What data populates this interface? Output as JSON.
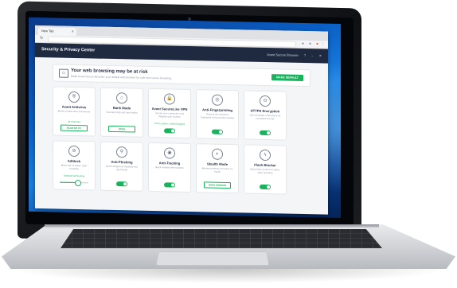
{
  "browser": {
    "tab_title": "New Tab",
    "tab_close": "✕",
    "refresh_icon": "↻"
  },
  "app": {
    "title": "Security & Privacy Center",
    "header_tools": [
      "Avast Secure Browser",
      "?",
      "–",
      "✕"
    ]
  },
  "banner": {
    "title": "Your web browsing may be at risk",
    "subtitle": "Make Avast Secure Browser your default web browser for safe and secure browsing.",
    "button_label": "MAKE DEFAULT"
  },
  "cards": [
    {
      "title": "Avast Antivirus",
      "desc": "Blocks viruses and ransomware",
      "status": "All Protected",
      "control": "button",
      "button_label": "SCAN MY PC",
      "icon": "shield-icon"
    },
    {
      "title": "Bank Mode",
      "desc": "Securely shop and bank online",
      "status": "",
      "control": "button",
      "button_label": "OPEN",
      "icon": "bank-icon"
    },
    {
      "title": "Avast SecureLine VPN",
      "desc": "Secure your connection and disguise your location",
      "status": "VPN Location: United Kingdom",
      "control": "toggle",
      "on": true,
      "icon": "lock-icon"
    },
    {
      "title": "Anti-Fingerprinting",
      "desc": "Protects the browser's fingerprint and prevents tracking",
      "status": "",
      "control": "toggle",
      "on": true,
      "icon": "fingerprint-icon"
    },
    {
      "title": "HTTPS Encryption",
      "desc": "Use encrypted connections for increased security",
      "status": "",
      "control": "toggle",
      "on": true,
      "icon": "https-icon"
    },
    {
      "title": "Adblock",
      "desc": "Block ads for faster, safer browsing",
      "status": "Standard ad blocking",
      "control": "slider",
      "level": 0.6,
      "icon": "adblock-icon"
    },
    {
      "title": "Anti-Phishing",
      "desc": "Block dangerous websites and downloads",
      "status": "",
      "control": "toggle",
      "on": true,
      "icon": "fishhook-icon"
    },
    {
      "title": "Anti-Tracking",
      "desc": "Block invisible web trackers",
      "status": "",
      "control": "toggle",
      "on": true,
      "icon": "eye-icon"
    },
    {
      "title": "Stealth Mode",
      "desc": "Browse privately and leave no traces",
      "status": "",
      "control": "button",
      "button_label": "OPEN WINDOW",
      "icon": "mask-icon"
    },
    {
      "title": "Flash Blocker",
      "desc": "Block flash content for faster, safer browsing",
      "status": "",
      "control": "toggle",
      "on": true,
      "icon": "flash-icon"
    }
  ],
  "colors": {
    "accent": "#19b35d",
    "header": "#1f2a40"
  }
}
